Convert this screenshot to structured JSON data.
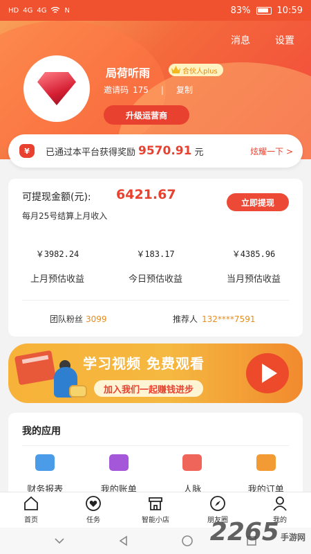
{
  "status_bar": {
    "left_indicators": [
      "HD",
      "4G",
      "4G",
      "wifi",
      "N"
    ],
    "battery": "83%",
    "time": "10:59"
  },
  "header": {
    "messages_label": "消息",
    "settings_label": "设置",
    "user_name": "局荷听雨",
    "partner_badge": "合伙人plus",
    "invite_label": "邀请码",
    "invite_code": "175",
    "copy_label": "复制",
    "upgrade_label": "升级运营商",
    "colors": {
      "primary": "#f0522f",
      "accent": "#e8412f"
    }
  },
  "reward": {
    "text": "已通过本平台获得奖励",
    "amount": "9570.91",
    "unit": "元",
    "link": "炫耀一下 >",
    "icon": "money-bag-icon"
  },
  "earnings": {
    "withdraw_label": "可提现金额(元):",
    "withdraw_amount": "6421.67",
    "withdraw_button": "立即提现",
    "settle_note": "每月25号结算上月收入",
    "stats": [
      {
        "value": "￥3982.24",
        "label": "上月预估收益"
      },
      {
        "value": "￥183.17",
        "label": "今日预估收益"
      },
      {
        "value": "￥4385.96",
        "label": "当月预估收益"
      }
    ],
    "team_label": "团队粉丝",
    "team_value": "3099",
    "referrer_label": "推荐人",
    "referrer_value": "132****7591"
  },
  "banner": {
    "title": "学习视频 免费观看",
    "subtitle": "加入我们一起赚钱进步"
  },
  "apps": {
    "title": "我的应用",
    "items": [
      {
        "label": "财务报表",
        "icon": "chart-icon"
      },
      {
        "label": "我的账单",
        "icon": "bill-icon"
      },
      {
        "label": "人脉",
        "icon": "contacts-icon"
      },
      {
        "label": "我的订单",
        "icon": "order-icon"
      }
    ]
  },
  "tabbar": {
    "items": [
      {
        "label": "首页",
        "icon": "home-icon"
      },
      {
        "label": "任务",
        "icon": "heart-icon"
      },
      {
        "label": "智能小店",
        "icon": "shop-icon"
      },
      {
        "label": "朋友圈",
        "icon": "compass-icon"
      },
      {
        "label": "我的",
        "icon": "user-icon"
      }
    ]
  },
  "watermark": {
    "text": "2265",
    "suffix": "手游网"
  }
}
